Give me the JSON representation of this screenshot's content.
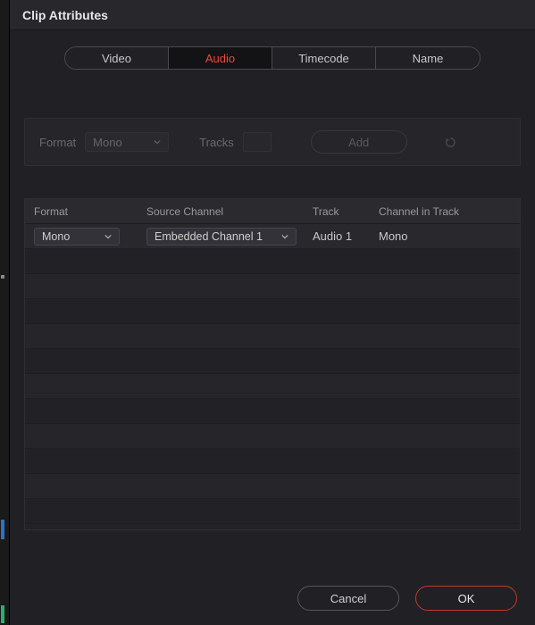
{
  "title": "Clip Attributes",
  "tabs": {
    "video": "Video",
    "audio": "Audio",
    "timecode": "Timecode",
    "name": "Name",
    "active": "audio"
  },
  "panel": {
    "format_label": "Format",
    "format_value": "Mono",
    "tracks_label": "Tracks",
    "tracks_value": "",
    "add_label": "Add"
  },
  "table": {
    "headers": {
      "format": "Format",
      "source": "Source Channel",
      "track": "Track",
      "channel": "Channel in Track"
    },
    "rows": [
      {
        "format": "Mono",
        "source": "Embedded Channel 1",
        "track": "Audio 1",
        "channel": "Mono"
      }
    ],
    "blank_row_count": 11
  },
  "footer": {
    "cancel": "Cancel",
    "ok": "OK"
  },
  "colors": {
    "accent": "#e64b3c"
  }
}
